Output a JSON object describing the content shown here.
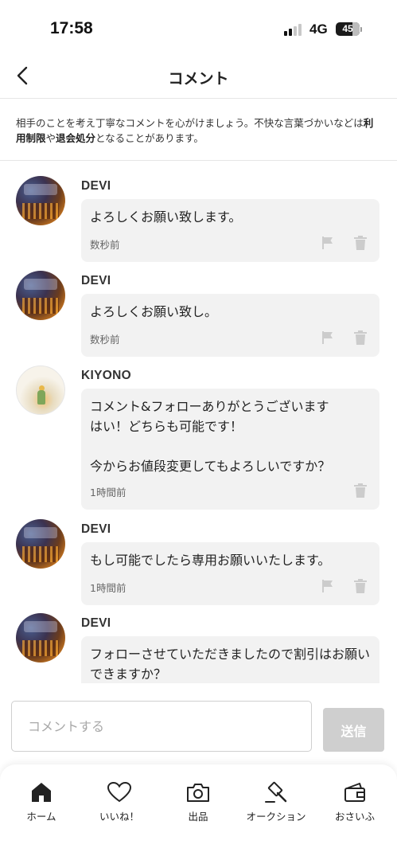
{
  "status_bar": {
    "time": "17:58",
    "network": "4G",
    "battery": "45"
  },
  "header": {
    "title": "コメント",
    "back_icon": "chevron-left-icon"
  },
  "notice": {
    "text_part1": "相手のことを考え丁寧なコメントを心がけましょう。不快な言葉づかいなどは",
    "bold1": "利用制限",
    "text_part2": "や",
    "bold2": "退会処分",
    "text_part3": "となることがあります。"
  },
  "comments": [
    {
      "user": "DEVI",
      "text": "よろしくお願い致します。",
      "time": "数秒前",
      "avatar": "devi-avatar",
      "has_flag": true
    },
    {
      "user": "DEVI",
      "text": "よろしくお願い致し。",
      "time": "数秒前",
      "avatar": "devi-avatar",
      "has_flag": true
    },
    {
      "user": "KIYONO",
      "text": "コメント&フォローありがとうございます\nはい！どちらも可能です！\n\n今からお値段変更してもよろしいですか？",
      "time": "1時間前",
      "avatar": "kiyono-avatar",
      "has_flag": false
    },
    {
      "user": "DEVI",
      "text": "もし可能でしたら専用お願いいたします。",
      "time": "1時間前",
      "avatar": "devi-avatar",
      "has_flag": true
    },
    {
      "user": "DEVI",
      "text": "フォローさせていただきましたので割引はお願いできますか？",
      "time": "",
      "avatar": "devi-avatar",
      "has_flag": true
    }
  ],
  "input": {
    "placeholder": "コメントする",
    "value": "",
    "send_label": "送信"
  },
  "bottom_nav": [
    {
      "label": "ホーム",
      "icon": "home-icon",
      "active": true
    },
    {
      "label": "いいね！",
      "icon": "heart-icon",
      "active": false
    },
    {
      "label": "出品",
      "icon": "camera-icon",
      "active": false
    },
    {
      "label": "オークション",
      "icon": "gavel-icon",
      "active": false
    },
    {
      "label": "おさいふ",
      "icon": "wallet-icon",
      "active": false
    }
  ],
  "colors": {
    "bubble_bg": "#f2f2f2",
    "send_disabled": "#cfcfcf",
    "icon_gray": "#cccccc"
  }
}
